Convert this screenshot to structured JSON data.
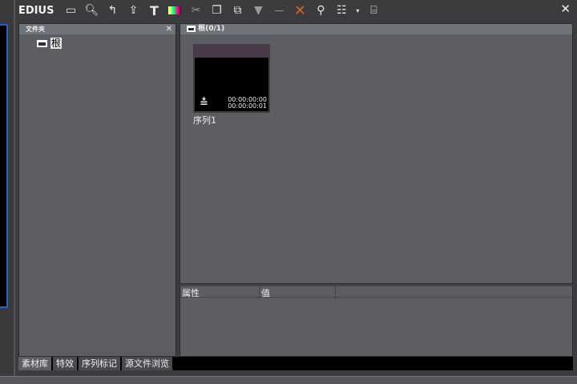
{
  "app": {
    "logo": "EDIUS"
  },
  "toolbar": {
    "icons": [
      "new-folder-icon",
      "search-icon",
      "up-folder-icon",
      "import-icon",
      "title-icon",
      "color-bars-icon",
      "cut-icon",
      "copy-icon",
      "paste-icon",
      "add-to-timeline-icon",
      "insert-icon",
      "delete-icon",
      "properties-icon",
      "view-icon",
      "view-dropdown-icon",
      "clip-icon"
    ]
  },
  "folder_panel": {
    "title": "文件夹",
    "root": "根"
  },
  "bin": {
    "title": "根(0/1)",
    "clip": {
      "name": "序列1",
      "tc_in": "00:00:00:00",
      "tc_out": "00:00:00:01"
    }
  },
  "properties": {
    "col_attr": "属性",
    "col_value": "值"
  },
  "tabs": [
    "素材库",
    "特效",
    "序列标记",
    "源文件浏览"
  ],
  "colors": {
    "delete": "#e06020",
    "panel": "#5d5e63",
    "header": "#6f737a"
  }
}
